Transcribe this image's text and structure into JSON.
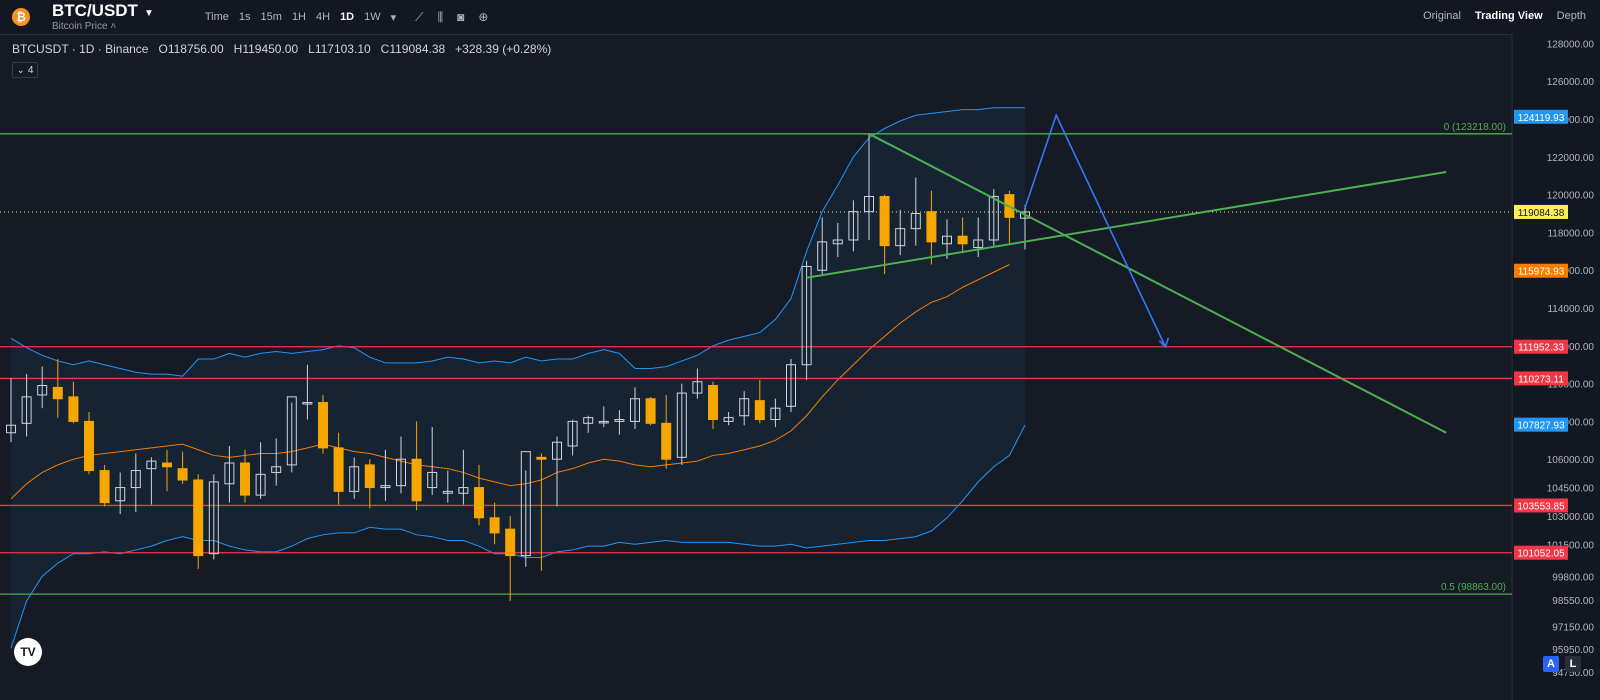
{
  "header": {
    "symbol": "BTC/USDT",
    "subtitle": "Bitcoin Price",
    "intervals": [
      "Time",
      "1s",
      "15m",
      "1H",
      "4H",
      "1D",
      "1W"
    ],
    "active_interval": "1D",
    "tabs": [
      "Original",
      "Trading View",
      "Depth"
    ],
    "active_tab": "Trading View"
  },
  "legend": {
    "title": "BTCUSDT · 1D · Binance",
    "open": "O118756.00",
    "high": "H119450.00",
    "low": "L117103.10",
    "close": "C119084.38",
    "change": "+328.39 (+0.28%)",
    "indicator_count": "4"
  },
  "colors": {
    "background": "#161a25",
    "up_candle": "#d1d4dc",
    "down_candle": "#f7a600",
    "bollinger": "#2196f3",
    "ma": "#f57c00",
    "support_resistance": "#f23645",
    "fib_trend": "#4caf50",
    "projection": "#3179f5"
  },
  "chart_data": {
    "type": "candlestick",
    "timeframe": "1D",
    "y_axis_ticks": [
      "128000.00",
      "126000.00",
      "124000.00",
      "122000.00",
      "120000.00",
      "118000.00",
      "116000.00",
      "114000.00",
      "112000.00",
      "110000.00",
      "108000.00",
      "106000.00",
      "104500.00",
      "103000.00",
      "101500.00",
      "99800.00",
      "98550.00",
      "97150.00",
      "95950.00",
      "94750.00"
    ],
    "y_range": [
      94000,
      128500
    ],
    "candles": [
      {
        "o": 107400,
        "h": 110300,
        "l": 106900,
        "c": 107800
      },
      {
        "o": 107900,
        "h": 110500,
        "l": 107200,
        "c": 109300
      },
      {
        "o": 109400,
        "h": 110900,
        "l": 108700,
        "c": 109900
      },
      {
        "o": 109800,
        "h": 111300,
        "l": 108200,
        "c": 109200
      },
      {
        "o": 109300,
        "h": 110100,
        "l": 107900,
        "c": 108000
      },
      {
        "o": 108000,
        "h": 108500,
        "l": 105200,
        "c": 105400
      },
      {
        "o": 105400,
        "h": 105700,
        "l": 103500,
        "c": 103700
      },
      {
        "o": 103800,
        "h": 105300,
        "l": 103100,
        "c": 104500
      },
      {
        "o": 104500,
        "h": 106300,
        "l": 103200,
        "c": 105400
      },
      {
        "o": 105500,
        "h": 106100,
        "l": 103600,
        "c": 105900
      },
      {
        "o": 105800,
        "h": 106500,
        "l": 104300,
        "c": 105600
      },
      {
        "o": 105500,
        "h": 106400,
        "l": 104700,
        "c": 104900
      },
      {
        "o": 104900,
        "h": 105200,
        "l": 100200,
        "c": 100900
      },
      {
        "o": 101000,
        "h": 105200,
        "l": 100700,
        "c": 104800
      },
      {
        "o": 104700,
        "h": 106700,
        "l": 103700,
        "c": 105800
      },
      {
        "o": 105800,
        "h": 106500,
        "l": 103700,
        "c": 104100
      },
      {
        "o": 104100,
        "h": 106900,
        "l": 103900,
        "c": 105200
      },
      {
        "o": 105300,
        "h": 107100,
        "l": 104600,
        "c": 105600
      },
      {
        "o": 105700,
        "h": 109000,
        "l": 105300,
        "c": 109300
      },
      {
        "o": 109000,
        "h": 111000,
        "l": 108100,
        "c": 109000
      },
      {
        "o": 109000,
        "h": 109400,
        "l": 106300,
        "c": 106600
      },
      {
        "o": 106600,
        "h": 107400,
        "l": 103600,
        "c": 104300
      },
      {
        "o": 104300,
        "h": 106100,
        "l": 103900,
        "c": 105600
      },
      {
        "o": 105700,
        "h": 106000,
        "l": 103400,
        "c": 104500
      },
      {
        "o": 104500,
        "h": 106500,
        "l": 103800,
        "c": 104600
      },
      {
        "o": 104600,
        "h": 107200,
        "l": 104200,
        "c": 106000
      },
      {
        "o": 106000,
        "h": 108000,
        "l": 103300,
        "c": 103800
      },
      {
        "o": 104500,
        "h": 107700,
        "l": 104100,
        "c": 105300
      },
      {
        "o": 104200,
        "h": 105400,
        "l": 103700,
        "c": 104300
      },
      {
        "o": 104200,
        "h": 106500,
        "l": 103600,
        "c": 104500
      },
      {
        "o": 104500,
        "h": 105700,
        "l": 102500,
        "c": 102900
      },
      {
        "o": 102900,
        "h": 103700,
        "l": 101500,
        "c": 102100
      },
      {
        "o": 102300,
        "h": 103000,
        "l": 98500,
        "c": 100900
      },
      {
        "o": 100900,
        "h": 105400,
        "l": 100300,
        "c": 106400
      },
      {
        "o": 106100,
        "h": 106300,
        "l": 100100,
        "c": 106000
      },
      {
        "o": 106000,
        "h": 107200,
        "l": 103500,
        "c": 106900
      },
      {
        "o": 106700,
        "h": 108100,
        "l": 106200,
        "c": 108000
      },
      {
        "o": 107900,
        "h": 108300,
        "l": 107400,
        "c": 108200
      },
      {
        "o": 108000,
        "h": 108800,
        "l": 107700,
        "c": 108000
      },
      {
        "o": 108000,
        "h": 108600,
        "l": 107300,
        "c": 108100
      },
      {
        "o": 108000,
        "h": 109800,
        "l": 107600,
        "c": 109200
      },
      {
        "o": 109200,
        "h": 109300,
        "l": 107800,
        "c": 107900
      },
      {
        "o": 107900,
        "h": 109400,
        "l": 105500,
        "c": 106000
      },
      {
        "o": 106100,
        "h": 110000,
        "l": 105700,
        "c": 109500
      },
      {
        "o": 109500,
        "h": 110800,
        "l": 109200,
        "c": 110100
      },
      {
        "o": 109900,
        "h": 110100,
        "l": 107600,
        "c": 108100
      },
      {
        "o": 108000,
        "h": 108500,
        "l": 107800,
        "c": 108200
      },
      {
        "o": 108300,
        "h": 109600,
        "l": 107800,
        "c": 109200
      },
      {
        "o": 109100,
        "h": 110200,
        "l": 107900,
        "c": 108100
      },
      {
        "o": 108100,
        "h": 109200,
        "l": 107700,
        "c": 108700
      },
      {
        "o": 108800,
        "h": 111300,
        "l": 108500,
        "c": 111000
      },
      {
        "o": 111000,
        "h": 116500,
        "l": 110200,
        "c": 116200
      },
      {
        "o": 116000,
        "h": 118800,
        "l": 115800,
        "c": 117500
      },
      {
        "o": 117400,
        "h": 118500,
        "l": 116700,
        "c": 117600
      },
      {
        "o": 117600,
        "h": 119700,
        "l": 117000,
        "c": 119100
      },
      {
        "o": 119100,
        "h": 123218,
        "l": 117600,
        "c": 119900
      },
      {
        "o": 119900,
        "h": 120000,
        "l": 115800,
        "c": 117300
      },
      {
        "o": 117300,
        "h": 119200,
        "l": 116800,
        "c": 118200
      },
      {
        "o": 118200,
        "h": 120900,
        "l": 117300,
        "c": 119000
      },
      {
        "o": 119100,
        "h": 120200,
        "l": 116300,
        "c": 117500
      },
      {
        "o": 117400,
        "h": 118700,
        "l": 116600,
        "c": 117800
      },
      {
        "o": 117800,
        "h": 118800,
        "l": 116900,
        "c": 117400
      },
      {
        "o": 117200,
        "h": 118800,
        "l": 116700,
        "c": 117600
      },
      {
        "o": 117600,
        "h": 120300,
        "l": 117200,
        "c": 119900
      },
      {
        "o": 120000,
        "h": 120200,
        "l": 117400,
        "c": 118800
      },
      {
        "o": 118756,
        "h": 119450,
        "l": 117103.1,
        "c": 119084.38
      }
    ],
    "bollinger_upper": [
      112400,
      111900,
      111500,
      111200,
      111000,
      111200,
      111000,
      110800,
      110600,
      110500,
      110500,
      110400,
      111300,
      111300,
      111600,
      111400,
      111600,
      111700,
      111600,
      111700,
      111800,
      112000,
      111900,
      111400,
      111100,
      111100,
      111100,
      111200,
      111400,
      111300,
      111100,
      111200,
      111100,
      111400,
      111200,
      111300,
      111300,
      111600,
      111800,
      111600,
      110800,
      110800,
      110900,
      111200,
      111500,
      112000,
      112300,
      112500,
      112700,
      113400,
      114500,
      117000,
      119100,
      120500,
      122000,
      123000,
      123500,
      123900,
      124200,
      124300,
      124400,
      124500,
      124500,
      124600,
      124600,
      124600
    ],
    "bollinger_lower": [
      96000,
      98500,
      99800,
      100500,
      101000,
      101000,
      101100,
      101000,
      101200,
      101400,
      101700,
      101900,
      101700,
      101700,
      101400,
      101200,
      101100,
      101100,
      101400,
      101800,
      102000,
      102100,
      102100,
      102400,
      102300,
      102300,
      102000,
      101900,
      101700,
      101700,
      101400,
      101000,
      101000,
      100800,
      100800,
      101100,
      101200,
      101400,
      101400,
      101600,
      101500,
      101600,
      101700,
      101600,
      101600,
      101600,
      101600,
      101500,
      101400,
      101400,
      101500,
      101300,
      101400,
      101500,
      101600,
      101700,
      101700,
      101800,
      101900,
      102200,
      102900,
      103800,
      104800,
      105600,
      106200,
      107800
    ],
    "moving_average": [
      103900,
      104700,
      105300,
      105700,
      106000,
      106200,
      106300,
      106400,
      106500,
      106600,
      106700,
      106800,
      106500,
      106200,
      106100,
      106200,
      106300,
      106300,
      106400,
      106600,
      106800,
      106600,
      106400,
      106300,
      106100,
      105900,
      105700,
      105600,
      105500,
      105300,
      105000,
      104800,
      104600,
      104700,
      104900,
      105300,
      105500,
      105800,
      106000,
      105900,
      105700,
      105600,
      105700,
      105800,
      105900,
      106200,
      106300,
      106500,
      106700,
      107000,
      107500,
      108300,
      109300,
      110200,
      111000,
      111800,
      112500,
      113200,
      113800,
      114300,
      114600,
      115100,
      115500,
      115900,
      116300
    ],
    "horizontal_levels": [
      {
        "price": 123218,
        "label": "0 (123218.00)",
        "kind": "fib"
      },
      {
        "price": 111952.33,
        "label": "111952.33",
        "kind": "level"
      },
      {
        "price": 110273.11,
        "label": "110273.11",
        "kind": "level"
      },
      {
        "price": 103553.85,
        "label": "103553.85",
        "kind": "level"
      },
      {
        "price": 101052.05,
        "label": "101052.05",
        "kind": "level"
      },
      {
        "price": 98863,
        "label": "0.5 (98863.00)",
        "kind": "fib"
      }
    ],
    "price_tags": [
      {
        "price": 124119.93,
        "label": "124119.93",
        "color": "#2196f3"
      },
      {
        "price": 119084.38,
        "label": "119084.38",
        "color": "#ffee58"
      },
      {
        "price": 115973.93,
        "label": "115973.93",
        "color": "#f57c00"
      },
      {
        "price": 111952.33,
        "label": "111952.33",
        "color": "#f23645"
      },
      {
        "price": 110273.11,
        "label": "110273.11",
        "color": "#f23645"
      },
      {
        "price": 107827.93,
        "label": "107827.93",
        "color": "#2196f3"
      },
      {
        "price": 103553.85,
        "label": "103553.85",
        "color": "#f23645"
      },
      {
        "price": 101052.05,
        "label": "101052.05",
        "color": "#f23645"
      }
    ],
    "trendlines": [
      {
        "from": {
          "i": 55,
          "p": 123218
        },
        "to": {
          "i": 92,
          "p": 107400
        }
      },
      {
        "from": {
          "i": 51,
          "p": 115600
        },
        "to": {
          "i": 92,
          "p": 121200
        }
      }
    ],
    "projection": [
      {
        "i": 65,
        "p": 119300
      },
      {
        "i": 67,
        "p": 124200
      },
      {
        "i": 74,
        "p": 111950
      }
    ]
  },
  "footer": {
    "logo": "TV",
    "auto_button": "A",
    "log_button": "L"
  }
}
